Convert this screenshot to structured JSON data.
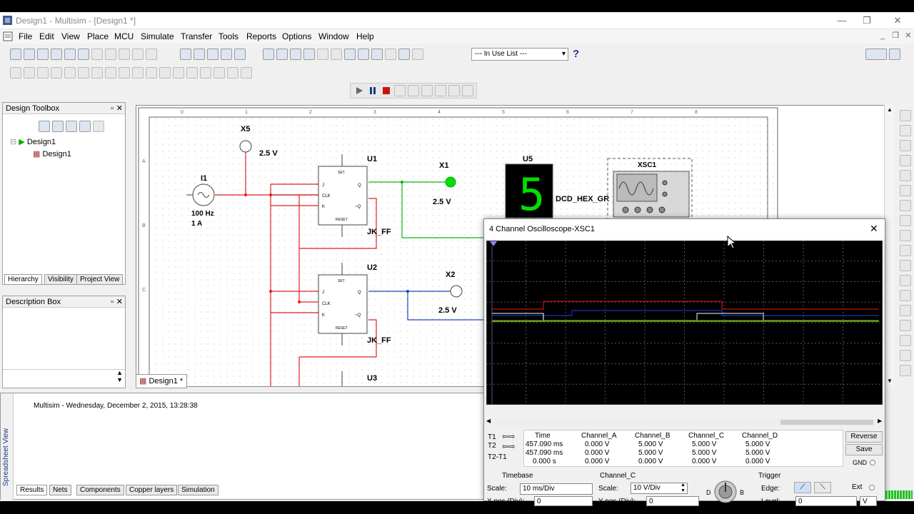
{
  "window": {
    "title": "Design1 - Multisim - [Design1 *]"
  },
  "menu": [
    "File",
    "Edit",
    "View",
    "Place",
    "MCU",
    "Simulate",
    "Transfer",
    "Tools",
    "Reports",
    "Options",
    "Window",
    "Help"
  ],
  "toolbar": {
    "in_use_list": "--- In Use List ---"
  },
  "design_toolbox": {
    "title": "Design Toolbox",
    "tree_root": "Design1",
    "tree_child": "Design1",
    "tabs": [
      "Hierarchy",
      "Visibility",
      "Project View"
    ]
  },
  "description_box": {
    "title": "Description Box"
  },
  "schematic": {
    "tab": "Design1 *",
    "components": {
      "x5": "X5",
      "x5_v": "2.5 V",
      "i1": "I1",
      "i1_f": "100 Hz",
      "i1_a": "1 A",
      "u1": "U1",
      "u2": "U2",
      "u3": "U3",
      "jkff1": "JK_FF",
      "jkff2": "JK_FF",
      "x1": "X1",
      "x1_v": "2.5 V",
      "x2": "X2",
      "x2_v": "2.5 V",
      "u5": "U5",
      "digit": "5",
      "dcd": "DCD_HEX_GR",
      "xsc1": "XSC1",
      "pin_set": "SET",
      "pin_reset": "RESET",
      "pin_j": "J",
      "pin_clk": "CLK",
      "pin_k": "K",
      "pin_q": "Q",
      "pin_qn": "~Q"
    }
  },
  "ruler": {
    "top": [
      "0",
      "1",
      "2",
      "3",
      "4",
      "5",
      "6",
      "7",
      "8"
    ],
    "left": [
      "A",
      "B",
      "C"
    ]
  },
  "spreadsheet": {
    "title": "Spreadsheet View",
    "log": "Multisim  -  Wednesday, December 2, 2015, 13:28:38",
    "tabs": [
      "Results",
      "Nets",
      "Components",
      "Copper layers",
      "Simulation"
    ]
  },
  "oscilloscope": {
    "title": "4 Channel Oscilloscope-XSC1",
    "headers": [
      "Time",
      "Channel_A",
      "Channel_B",
      "Channel_C",
      "Channel_D"
    ],
    "rows": [
      {
        "label": "T1",
        "values": [
          "457.090 ms",
          "0.000 V",
          "5.000 V",
          "5.000 V",
          "5.000 V"
        ]
      },
      {
        "label": "T2",
        "values": [
          "457.090 ms",
          "0.000 V",
          "5.000 V",
          "5.000 V",
          "5.000 V"
        ]
      },
      {
        "label": "T2-T1",
        "values": [
          "0.000 s",
          "0.000 V",
          "0.000 V",
          "0.000 V",
          "0.000 V"
        ]
      }
    ],
    "reverse": "Reverse",
    "save": "Save",
    "gnd": "GND",
    "timebase": {
      "title": "Timebase",
      "scale_label": "Scale:",
      "scale": "10 ms/Div",
      "xpos_label": "X pos.(Div):",
      "xpos": "0"
    },
    "channel": {
      "title": "Channel_C",
      "scale_label": "Scale:",
      "scale": "10  V/Div",
      "ypos_label": "Y pos.(Div):",
      "ypos": "0"
    },
    "trigger": {
      "title": "Trigger",
      "edge_label": "Edge:",
      "ext": "Ext",
      "level_label": "Level:",
      "level": "0",
      "level_unit": "V"
    },
    "knob": {
      "d": "D",
      "b": "B"
    }
  },
  "colors": {
    "red_wire": "#e02020",
    "green_wire": "#00c000",
    "blue_wire": "#2040c0",
    "led": "#00e000",
    "screen": "#000000"
  }
}
